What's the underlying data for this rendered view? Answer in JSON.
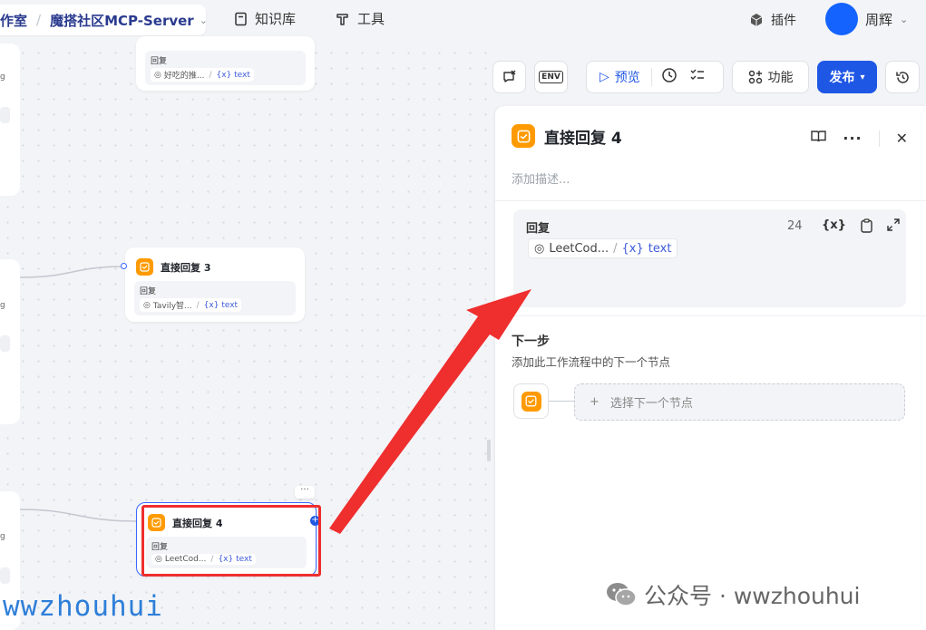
{
  "header": {
    "workspace_suffix": "作室",
    "project_name": "魔搭社区MCP-Server",
    "nav_knowledge": "知识库",
    "nav_tools": "工具",
    "plugins": "插件",
    "user_name": "周辉"
  },
  "canvas": {
    "top_node": {
      "reply_label": "回复",
      "chip_text": "好吃的推...",
      "var_text": "text"
    },
    "node3": {
      "title": "直接回复 3",
      "reply_label": "回复",
      "chip_text": "Tavily智...",
      "var_text": "text"
    },
    "node4": {
      "title": "直接回复 4",
      "reply_label": "回复",
      "chip_text": "LeetCod...",
      "var_text": "text",
      "more": "···"
    },
    "stub_text": "g"
  },
  "toolbar": {
    "env": "ENV",
    "preview": "预览",
    "features": "功能",
    "publish": "发布"
  },
  "panel": {
    "title": "直接回复 4",
    "description_placeholder": "添加描述...",
    "reply_label": "回复",
    "char_count": "24",
    "var_tool": "{x}",
    "chip_text": "LeetCod...",
    "chip_var": "{x}",
    "chip_var_name": "text",
    "next_step_title": "下一步",
    "next_step_desc": "添加此工作流程中的下一个节点",
    "select_next": "选择下一个节点"
  },
  "watermark": {
    "left": "wwzhouhui",
    "right": "公众号 · wwzhouhui"
  },
  "colors": {
    "accent": "#1f57e5",
    "node_icon": "#ff9a00",
    "annotation": "#ef2e2e"
  }
}
